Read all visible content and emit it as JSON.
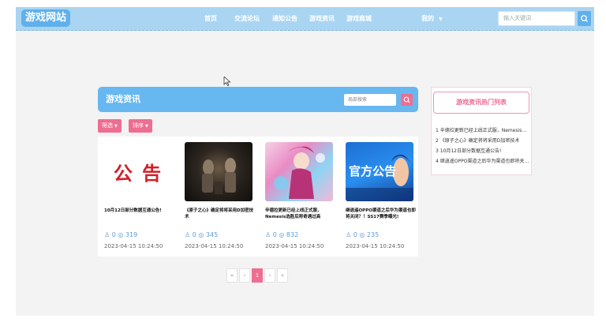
{
  "nav": {
    "logo": "游戏网站",
    "items": [
      "首页",
      "交流论坛",
      "通知公告",
      "游戏资讯",
      "游戏商城"
    ],
    "mine": "我的",
    "search_placeholder": "输入关键词"
  },
  "panel": {
    "title": "游戏资讯",
    "search_placeholder": "局部搜索",
    "filter_label": "筛选",
    "sort_label": "排序"
  },
  "cards": [
    {
      "image_text": "公 告",
      "title": "10月12日部分数据互通公告!",
      "likes": "0",
      "views": "319",
      "date": "2023-04-15 10:24:50"
    },
    {
      "title": "《原子之心》确定将将采用D加密技术",
      "likes": "0",
      "views": "345",
      "date": "2023-04-15 10:24:50"
    },
    {
      "title": "辛德拉更新已经上线正式服，Nemesis选胜后称奇遇过高",
      "likes": "0",
      "views": "832",
      "date": "2023-04-15 10:24:50"
    },
    {
      "image_text": "官方公告",
      "title": "继逍遥OPPO渠道之后华为渠道也即将关闭？！SS17赛季曝光!",
      "likes": "0",
      "views": "235",
      "date": "2023-04-15 10:24:50"
    }
  ],
  "pager": {
    "first": "«",
    "prev": "‹",
    "current": "1",
    "next": "›",
    "last": "»"
  },
  "hot": {
    "title": "游戏资讯热门列表",
    "items": [
      "1  辛德拉更新已经上线正式服，Nemesis选胜后称奇遇过高",
      "2  《原子之心》确定将将采用D加密技术",
      "3  10月12日部分数据互通公告!",
      "4  继逍遥OPPO渠道之后华为渠道也即将关闭？！SS17赛季曝光!"
    ]
  },
  "colors": {
    "primary": "#67b7f0",
    "accent": "#ee6e92",
    "navbar": "#a9d5f2"
  }
}
